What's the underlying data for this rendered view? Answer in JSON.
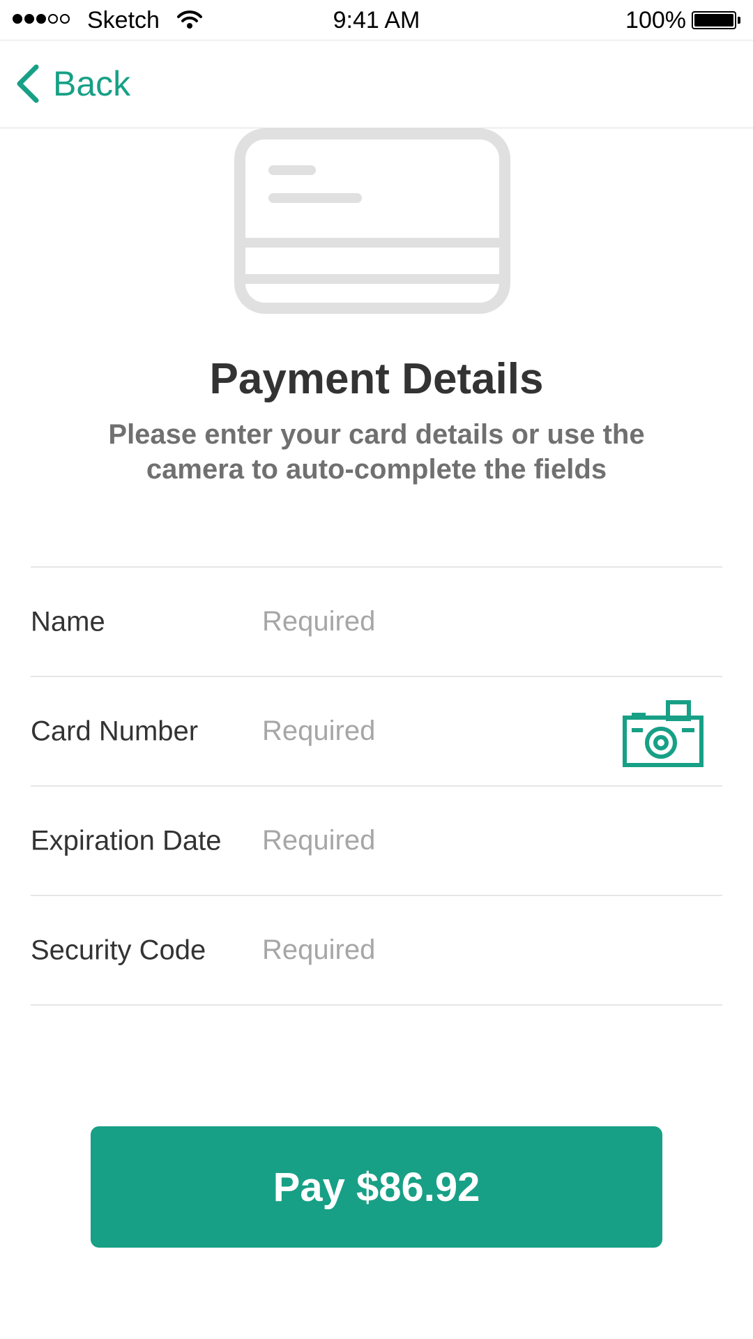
{
  "status_bar": {
    "carrier": "Sketch",
    "time": "9:41 AM",
    "battery": "100%"
  },
  "nav": {
    "back_label": "Back"
  },
  "header": {
    "title": "Payment Details",
    "subtitle": "Please enter your card details or use the camera to auto-complete the fields"
  },
  "form": {
    "fields": [
      {
        "label": "Name",
        "placeholder": "Required",
        "value": ""
      },
      {
        "label": "Card Number",
        "placeholder": "Required",
        "value": ""
      },
      {
        "label": "Expiration Date",
        "placeholder": "Required",
        "value": ""
      },
      {
        "label": "Security Code",
        "placeholder": "Required",
        "value": ""
      }
    ]
  },
  "pay_button": {
    "label": "Pay $86.92"
  },
  "icons": {
    "back": "chevron-left-icon",
    "card": "credit-card-icon",
    "camera": "camera-icon",
    "wifi": "wifi-icon",
    "battery": "battery-icon"
  },
  "colors": {
    "accent": "#17a086",
    "title": "#333333",
    "subtitle": "#707070",
    "placeholder": "#a6a6a6",
    "divider": "#e6e6e6",
    "illustration": "#e0e0e0"
  }
}
